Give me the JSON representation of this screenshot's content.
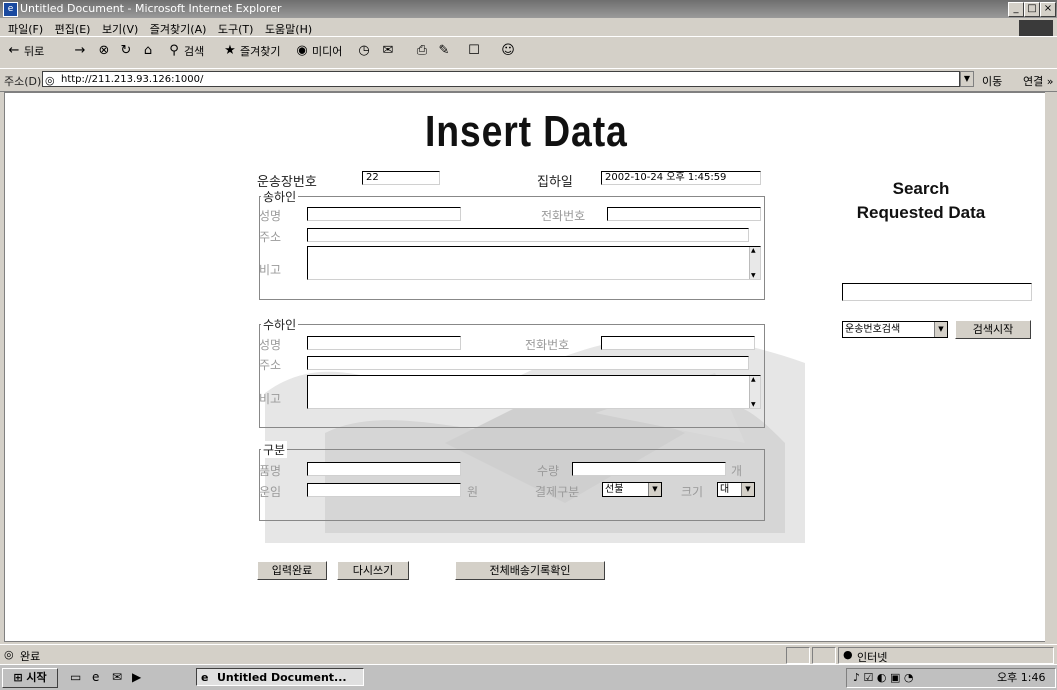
{
  "window": {
    "title": "Untitled Document - Microsoft Internet Explorer",
    "controls": {
      "minimize": "_",
      "restore": "□",
      "close": "×"
    }
  },
  "menu": [
    "파일(F)",
    "편집(E)",
    "보기(V)",
    "즐겨찾기(A)",
    "도구(T)",
    "도움말(H)"
  ],
  "toolbar": {
    "back": "뒤로",
    "search": "검색",
    "favorites": "즐겨찾기",
    "media": "미디어"
  },
  "address": {
    "label": "주소(D)",
    "url": "http://211.213.93.126:1000/",
    "go": "이동",
    "links": "연결 »"
  },
  "page": {
    "title": "Insert Data",
    "waybill_label": "운송장번호",
    "waybill_value": "22",
    "pickup_date_label": "집하일",
    "pickup_date_value": "2002-10-24 오후 1:45:59",
    "sender": {
      "legend": "송하인",
      "name": "성명",
      "phone": "전화번호",
      "address": "주소",
      "note": "비고"
    },
    "receiver": {
      "legend": "수하인",
      "name": "성명",
      "phone": "전화번호",
      "address": "주소",
      "note": "비고"
    },
    "category": {
      "legend": "구분",
      "item_label": "품명",
      "qty_label": "수량",
      "qty_unit": "개",
      "fare_label": "운임",
      "fare_unit": "원",
      "payment_label": "결제구분",
      "payment_value": "선불",
      "size_label": "크기",
      "size_value": "대"
    },
    "buttons": {
      "submit": "입력완료",
      "reset": "다시쓰기",
      "all_records": "전체배송기록확인"
    }
  },
  "search": {
    "title_line1": "Search",
    "title_line2": "Requested Data",
    "input_value": "",
    "select_value": "운송번호검색",
    "button": "검색시작"
  },
  "status": {
    "text": "완료",
    "zone": "인터넷"
  },
  "taskbar": {
    "start": "시작",
    "task": "Untitled Document...",
    "clock": "오후 1:46"
  }
}
